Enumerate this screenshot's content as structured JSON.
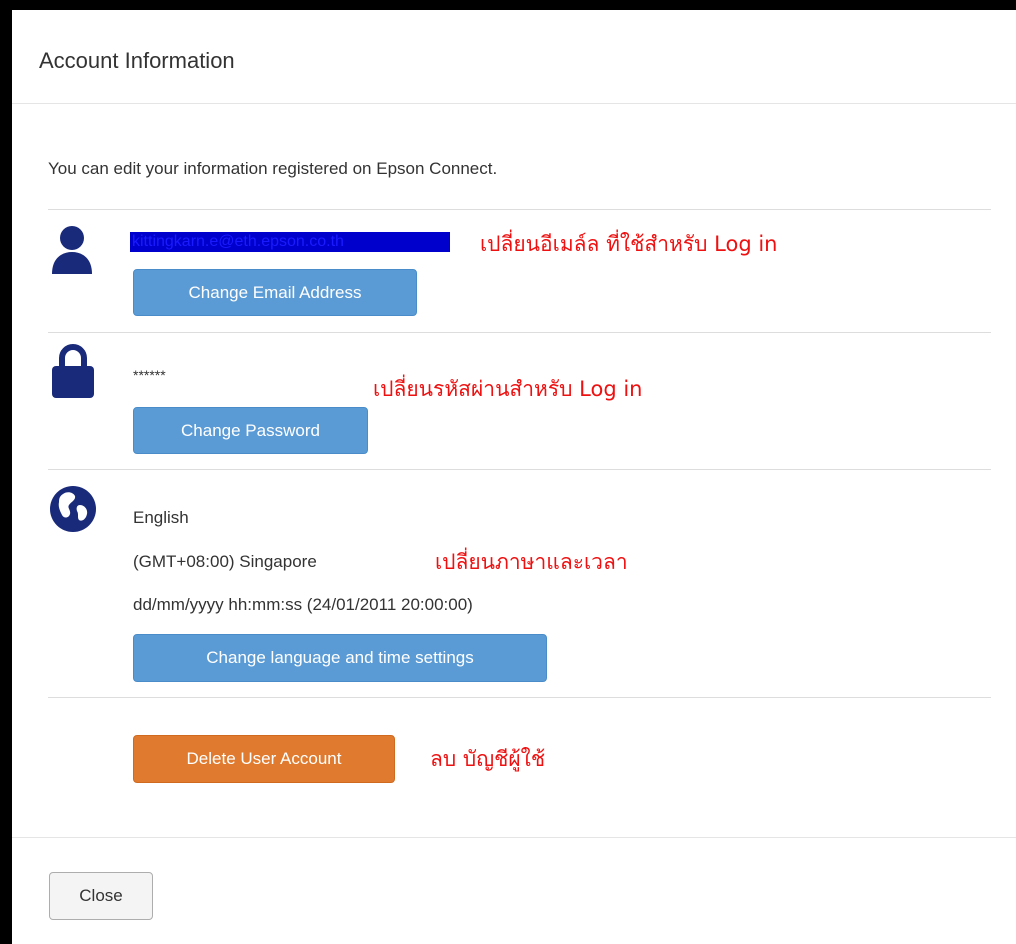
{
  "dialog": {
    "title": "Account Information",
    "intro": "You can edit your information registered on Epson Connect.",
    "close_label": "Close"
  },
  "email_section": {
    "icon": "user-icon",
    "email": "kittingkarn.e@eth.epson.co.th",
    "button_label": "Change Email Address",
    "annotation": "เปลี่ยนอีเมล์ล ที่ใช้สำหรับ Log in"
  },
  "password_section": {
    "icon": "lock-icon",
    "password_mask": "******",
    "button_label": "Change Password",
    "annotation": "เปลี่ยนรหัสผ่านสำหรับ Log in"
  },
  "language_section": {
    "icon": "globe-icon",
    "language": "English",
    "timezone": "(GMT+08:00) Singapore",
    "date_format": "dd/mm/yyyy hh:mm:ss (24/01/2011 20:00:00)",
    "button_label": "Change language and time settings",
    "annotation": "เปลี่ยนภาษาและเวลา"
  },
  "delete_section": {
    "button_label": "Delete User Account",
    "annotation": "ลบ บัญชีผู้ใช้"
  },
  "colors": {
    "icon": "#1a2a7a",
    "primary_button": "#5b9bd5",
    "danger_button": "#e07a2e",
    "annotation": "#ee1111"
  }
}
